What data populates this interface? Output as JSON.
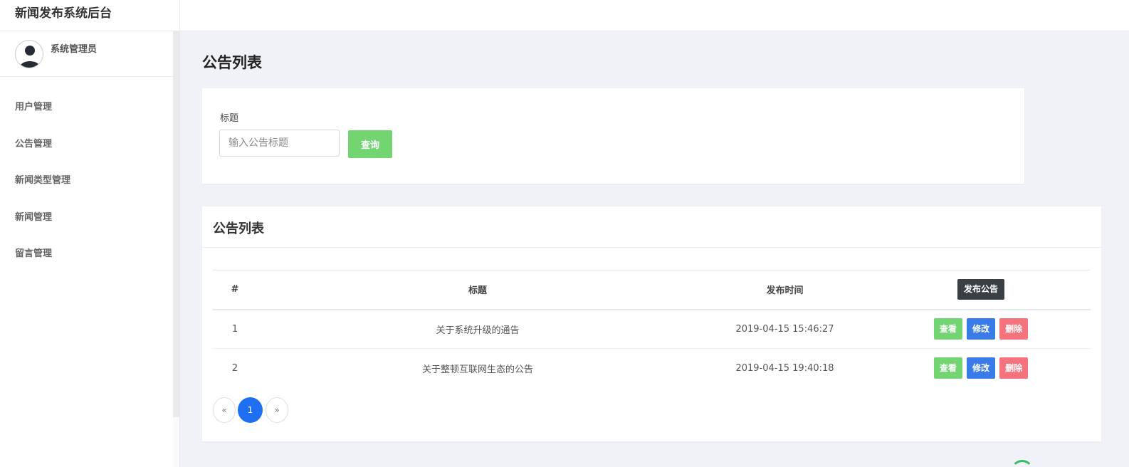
{
  "app": {
    "title": "新闻发布系统后台"
  },
  "user": {
    "name": "系统管理员",
    "avatar_icon": "user-avatar-icon"
  },
  "sidebar": {
    "items": [
      {
        "label": "用户管理"
      },
      {
        "label": "公告管理"
      },
      {
        "label": "新闻类型管理"
      },
      {
        "label": "新闻管理"
      },
      {
        "label": "留言管理"
      }
    ]
  },
  "page": {
    "title": "公告列表"
  },
  "search": {
    "label": "标题",
    "placeholder": "输入公告标题",
    "value": "",
    "query_button": "查询"
  },
  "list": {
    "title": "公告列表",
    "columns": {
      "num": "#",
      "title": "标题",
      "time": "发布时间"
    },
    "publish_button": "发布公告",
    "rows": [
      {
        "num": "1",
        "title": "关于系统升级的通告",
        "time": "2019-04-15 15:46:27"
      },
      {
        "num": "2",
        "title": "关于整顿互联网生态的公告",
        "time": "2019-04-15 19:40:18"
      }
    ],
    "actions": {
      "view": "查看",
      "edit": "修改",
      "delete": "删除"
    }
  },
  "pagination": {
    "prev": "«",
    "current": "1",
    "next": "»"
  },
  "colors": {
    "success": "#72d572",
    "primary": "#3a7bea",
    "danger": "#f5737c",
    "dark": "#3a3f44",
    "page_active": "#1f6ff2"
  }
}
